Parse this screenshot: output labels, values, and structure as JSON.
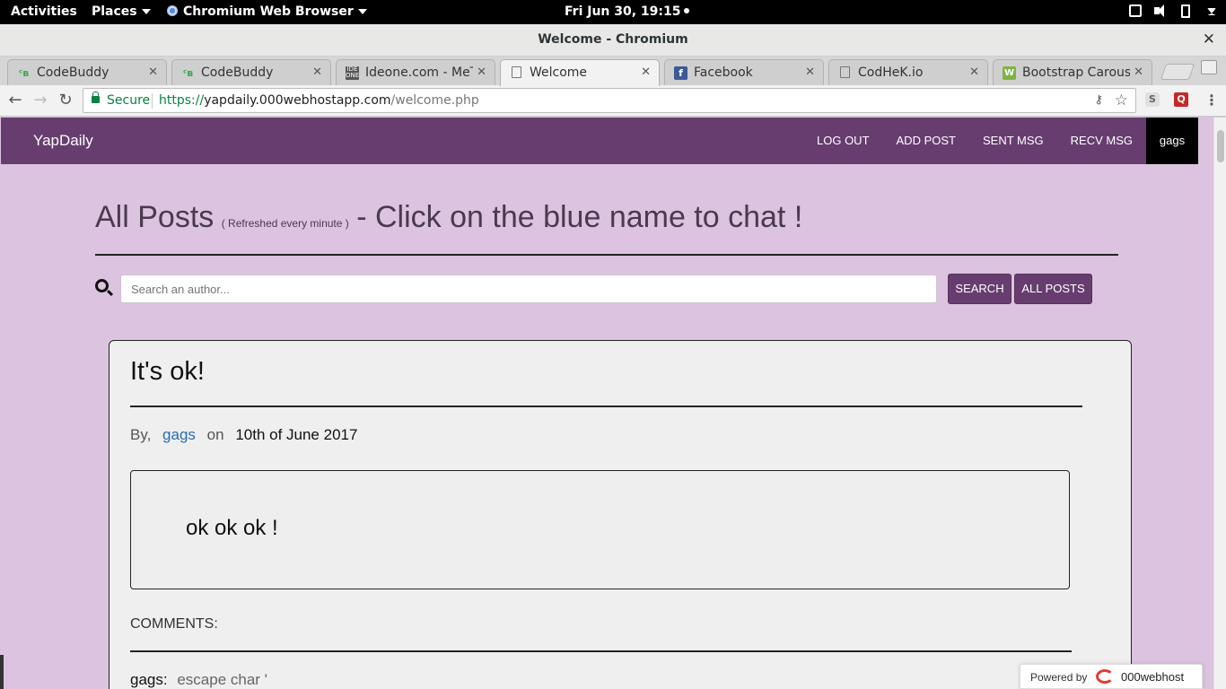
{
  "os_bar": {
    "activities": "Activities",
    "places": "Places",
    "app": "Chromium Web Browser",
    "clock": "Fri Jun 30, 19:15"
  },
  "window": {
    "title": "Welcome - Chromium",
    "close": "✕"
  },
  "tabs": [
    {
      "title": "CodeBuddy",
      "icon": "codebuddy-icon",
      "glyph": "ᶜʙ"
    },
    {
      "title": "CodeBuddy",
      "icon": "codebuddy-icon",
      "glyph": "ᶜʙ"
    },
    {
      "title": "Ideone.com - MeT",
      "icon": "ideone-icon",
      "glyph": "IDE ONE"
    },
    {
      "title": "Welcome",
      "icon": "document-icon",
      "glyph": ""
    },
    {
      "title": "Facebook",
      "icon": "facebook-icon",
      "glyph": "f"
    },
    {
      "title": "CodHeK.io",
      "icon": "document-icon",
      "glyph": ""
    },
    {
      "title": "Bootstrap Carous",
      "icon": "bootstrap-icon",
      "glyph": "W"
    }
  ],
  "tab_close": "✕",
  "toolbar": {
    "back": "←",
    "forward": "→",
    "reload": "↻",
    "secure_label": "Secure",
    "url_scheme": "https://",
    "url_host": "yapdaily.000webhostapp.com",
    "url_path": "/welcome.php",
    "ext_s": "S",
    "ext_q": "Q",
    "menu": "⋮",
    "key_glyph": "⚷",
    "star_glyph": "☆"
  },
  "site": {
    "brand": "YapDaily",
    "nav": [
      "LOG OUT",
      "ADD POST",
      "SENT MSG",
      "RECV MSG"
    ],
    "user": "gags",
    "colors": {
      "primary": "#673d70",
      "background": "#dcc3df",
      "link": "#2a6bb0"
    }
  },
  "heading": {
    "main": "All Posts",
    "note": "( Refreshed every minute )",
    "tail": "- Click on the blue name to chat !"
  },
  "search": {
    "placeholder": "Search an author...",
    "search_button": "SEARCH",
    "all_posts_button": "ALL POSTS"
  },
  "post": {
    "title": "It's ok!",
    "by_label": "By,",
    "author": "gags",
    "on_label": "on",
    "date": "10th of June 2017",
    "body": "ok ok ok !",
    "comments_label": "COMMENTS:",
    "comments": [
      {
        "author": "gags:",
        "text": "escape char '"
      }
    ]
  },
  "footer_badge": {
    "label": "Powered by",
    "brand": "000webhost"
  }
}
